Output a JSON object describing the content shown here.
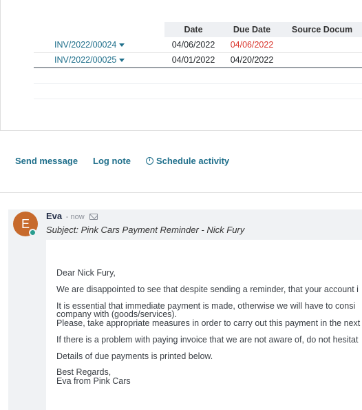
{
  "table": {
    "headers": [
      "Date",
      "Due Date",
      "Source Docum"
    ],
    "rows": [
      {
        "invoice": "INV/2022/00024",
        "date": "04/06/2022",
        "due_date": "04/06/2022",
        "source": ""
      },
      {
        "invoice": "INV/2022/00025",
        "date": "04/01/2022",
        "due_date": "04/20/2022",
        "source": ""
      }
    ]
  },
  "chatter": {
    "send_message": "Send message",
    "log_note": "Log note",
    "schedule_activity": "Schedule activity"
  },
  "message": {
    "avatar_letter": "E",
    "author": "Eva",
    "time": "- now",
    "subject": "Subject: Pink Cars Payment Reminder - Nick Fury",
    "lines": [
      "Dear Nick Fury,",
      "We are disappointed to see that despite sending a reminder, that your account i",
      "It is essential that immediate payment is made, otherwise we will have to consi",
      "company with (goods/services).",
      "Please, take appropriate measures in order to carry out this payment in the next",
      "If there is a problem with paying invoice that we are not aware of, do not hesitat",
      "Details of due payments is printed below.",
      "Best Regards,",
      "Eva from Pink Cars"
    ]
  },
  "colors": {
    "link": "#1f6f8b",
    "overdue": "#d9342b",
    "avatar": "#c76a2c",
    "online": "#2a9d8f"
  }
}
